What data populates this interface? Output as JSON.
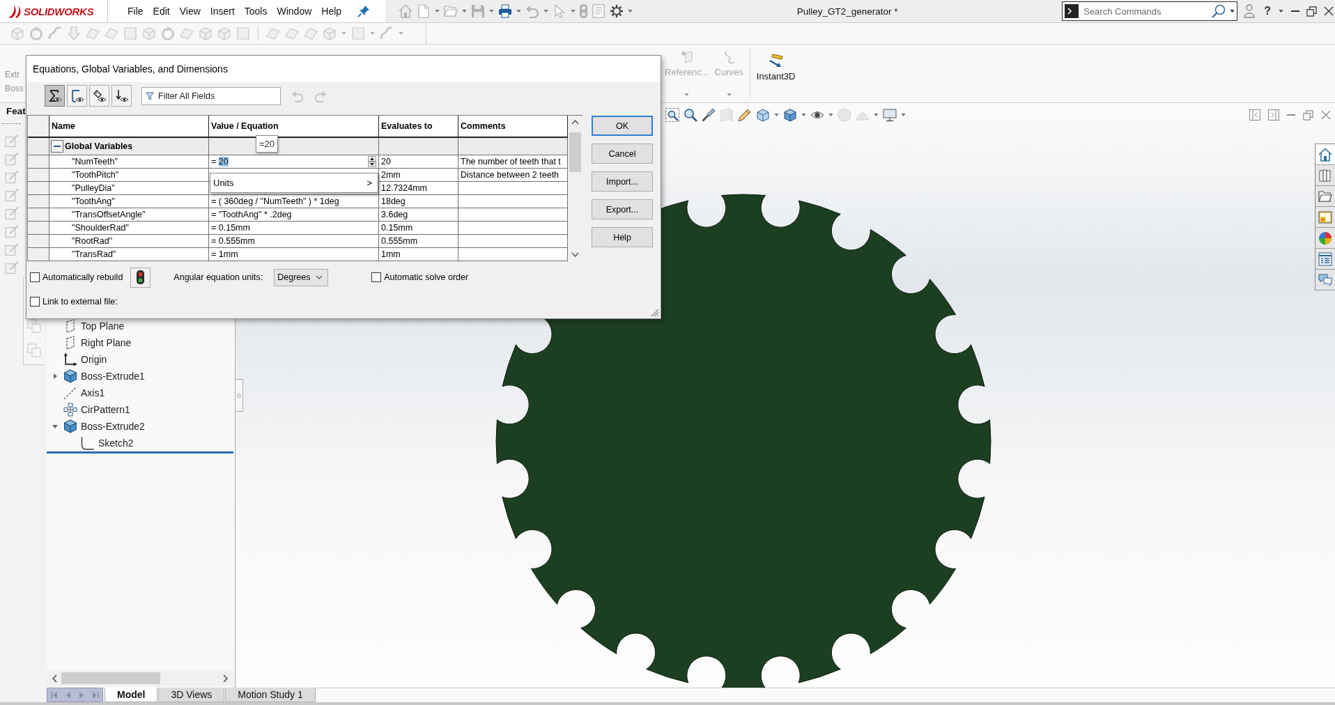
{
  "title_bar": {
    "logo": "SOLIDWORKS",
    "menus": [
      "File",
      "Edit",
      "View",
      "Insert",
      "Tools",
      "Window",
      "Help"
    ],
    "document_title": "Pulley_GT2_generator *",
    "search": {
      "placeholder": "Search Commands"
    },
    "help_glyph": "?"
  },
  "features_toolbar": {
    "disabled": true
  },
  "command_manager": {
    "cut_labels": [
      "Extr",
      "Boss"
    ],
    "tools": [
      {
        "kind": "reference",
        "label": "Referenc...",
        "disabled": true
      },
      {
        "kind": "curves",
        "label": "Curves",
        "disabled": true
      },
      {
        "kind": "instant3d",
        "label": "Instant3D",
        "disabled": false
      }
    ]
  },
  "feature_manager": {
    "tab_label": "Feat",
    "tree": [
      {
        "kind": "plane",
        "label": "Top Plane"
      },
      {
        "kind": "plane",
        "label": "Right Plane"
      },
      {
        "kind": "origin",
        "label": "Origin"
      },
      {
        "kind": "extrude",
        "label": "Boss-Extrude1",
        "expanded": false
      },
      {
        "kind": "axis",
        "label": "Axis1"
      },
      {
        "kind": "pattern",
        "label": "CirPattern1"
      },
      {
        "kind": "extrude",
        "label": "Boss-Extrude2",
        "expanded": true,
        "children": [
          {
            "kind": "sketch",
            "label": "Sketch2"
          }
        ]
      }
    ],
    "bottom_tabs": [
      {
        "label": "Model",
        "selected": true
      },
      {
        "label": "3D Views",
        "selected": false
      },
      {
        "label": "Motion Study 1",
        "selected": false
      }
    ]
  },
  "graphics": {
    "task_pane_tabs": [
      {
        "kind": "home",
        "selected": true
      },
      {
        "kind": "library",
        "selected": false
      },
      {
        "kind": "files",
        "selected": false
      },
      {
        "kind": "palette",
        "selected": false
      },
      {
        "kind": "appearance",
        "selected": false
      },
      {
        "kind": "properties",
        "selected": false
      },
      {
        "kind": "forum",
        "selected": false
      }
    ]
  },
  "dialog": {
    "title": "Equations, Global Variables, and Dimensions",
    "view_buttons": [
      {
        "kind": "equations",
        "selected": true
      },
      {
        "kind": "sketch",
        "selected": false
      },
      {
        "kind": "dimensions",
        "selected": false
      },
      {
        "kind": "ordered",
        "selected": false
      }
    ],
    "filter": {
      "placeholder": "Filter All Fields"
    },
    "history_buttons": [
      {
        "kind": "undo",
        "disabled": true
      },
      {
        "kind": "redo",
        "disabled": true
      }
    ],
    "table": {
      "columns": [
        "Name",
        "Value / Equation",
        "Evaluates to",
        "Comments"
      ],
      "group": {
        "label": "Global Variables",
        "expanded": true
      },
      "rows": [
        {
          "name": "\"NumTeeth\"",
          "editing": true,
          "value": "=",
          "selected_text": "20",
          "result": "20",
          "comment": "The number of teeth that t"
        },
        {
          "name": "\"ToothPitch\"",
          "editing": false,
          "result": "2mm",
          "comment": "Distance between 2 teeth"
        },
        {
          "name": "\"PulleyDia\"",
          "editing": false,
          "result": "12.7324mm"
        },
        {
          "name": "\"ToothAng\"",
          "editing": false,
          "value": "= ( 360deg / \"NumTeeth\" ) * 1deg",
          "result": "18deg"
        },
        {
          "name": "\"TransOffsetAngle\"",
          "editing": false,
          "value": "= \"ToothAng\" * .2deg",
          "result": "3.6deg"
        },
        {
          "name": "\"ShoulderRad\"",
          "editing": false,
          "value": "= 0.15mm",
          "result": "0.15mm"
        },
        {
          "name": "\"RootRad\"",
          "editing": false,
          "value": "= 0.555mm",
          "result": "0.555mm"
        },
        {
          "name": "\"TransRad\"",
          "editing": false,
          "value": "= 1mm",
          "result": "1mm"
        }
      ]
    },
    "tooltip": "=20",
    "popup_menu": [
      {
        "label": "Units",
        "submenu_arrow": ">"
      }
    ],
    "options": {
      "auto_rebuild": {
        "label": "Automatically rebuild",
        "checked": false
      },
      "angular_units": {
        "label": "Angular equation units:",
        "value": "Degrees"
      },
      "auto_solve_order": {
        "label": "Automatic solve order",
        "checked": false
      },
      "link_external": {
        "label": "Link to external file:",
        "checked": false
      }
    },
    "buttons": [
      {
        "label": "OK",
        "default": true
      },
      {
        "label": "Cancel",
        "default": false
      },
      {
        "label": "Import...",
        "default": false
      },
      {
        "label": "Export...",
        "default": false
      },
      {
        "label": "Help",
        "default": false
      }
    ]
  }
}
